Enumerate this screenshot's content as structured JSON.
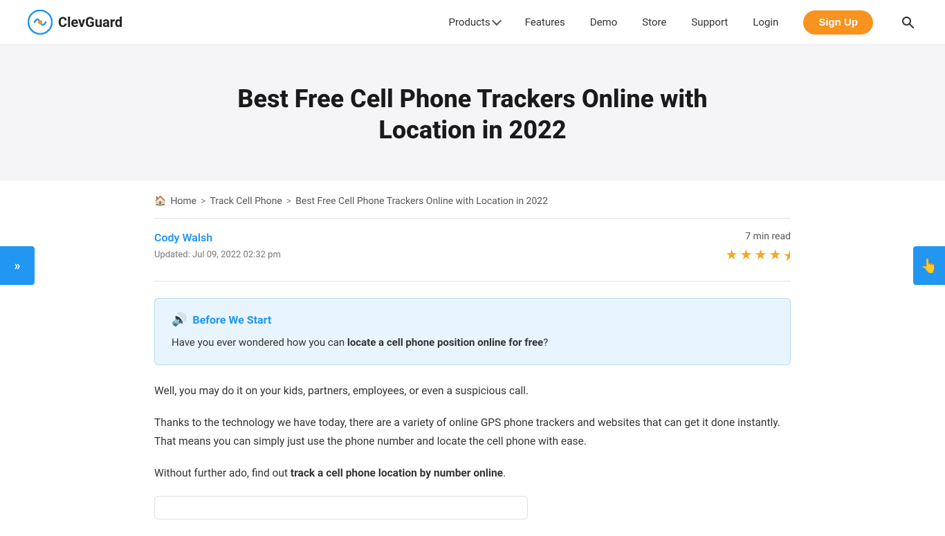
{
  "site": {
    "logo_text": "ClevGuard",
    "logo_alt": "ClevGuard Logo"
  },
  "nav": {
    "products_label": "Products",
    "features_label": "Features",
    "demo_label": "Demo",
    "store_label": "Store",
    "support_label": "Support",
    "login_label": "Login",
    "signup_label": "Sign Up"
  },
  "hero": {
    "title": "Best Free Cell Phone Trackers Online with Location in 2022"
  },
  "breadcrumb": {
    "home": "Home",
    "track_cell_phone": "Track Cell Phone",
    "current": "Best Free Cell Phone Trackers Online with Location in 2022"
  },
  "article": {
    "author": "Cody Walsh",
    "updated": "Updated: Jul 09, 2022 02:32 pm",
    "read_time": "7 min read",
    "stars": [
      1,
      1,
      1,
      1,
      0.5
    ],
    "callout_title": "Before We Start",
    "callout_text_pre": "Have you ever wondered how you can ",
    "callout_highlight": "locate a cell phone position online for free",
    "callout_text_post": "?",
    "para1": "Well, you may do it on your kids, partners, employees, or even a suspicious call.",
    "para2": "Thanks to the technology we have today, there are a variety of online GPS phone trackers and websites that can get it done instantly. That means you can simply just use the phone number and locate the cell phone with ease.",
    "para3_pre": "Without further ado, find out ",
    "para3_highlight": "track a cell phone location by number online",
    "para3_post": "."
  },
  "sidebar_toggle": {
    "icon": "»"
  },
  "float_btn": {
    "icon": "👆"
  }
}
